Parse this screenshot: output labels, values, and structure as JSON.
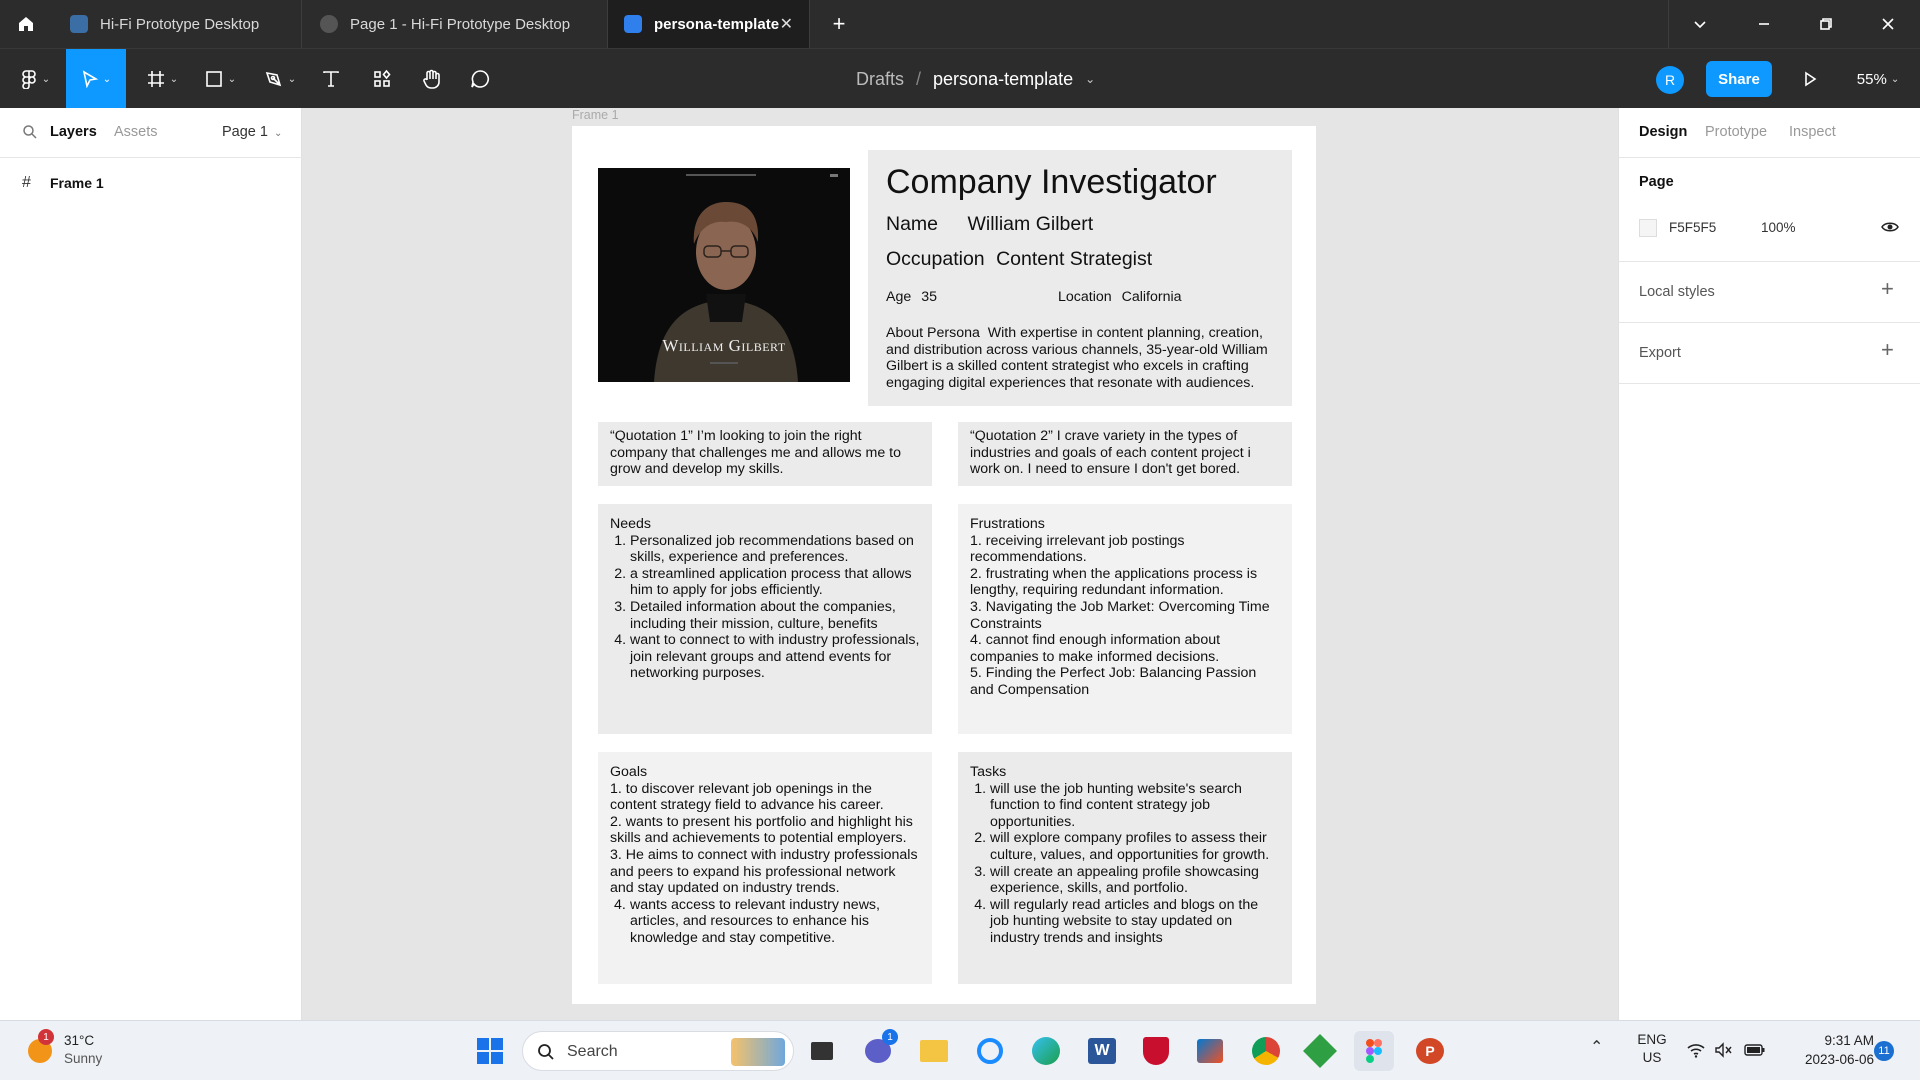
{
  "titlebar": {
    "tabs": [
      {
        "label": "Hi-Fi Prototype Desktop"
      },
      {
        "label": "Page 1 - Hi-Fi Prototype Desktop"
      },
      {
        "label": "persona-template"
      }
    ]
  },
  "toolbar": {
    "breadcrumb_root": "Drafts",
    "breadcrumb_sep": "/",
    "file_name": "persona-template",
    "avatar_initial": "R",
    "share_label": "Share",
    "zoom": "55%"
  },
  "left_panel": {
    "tabs": {
      "layers": "Layers",
      "assets": "Assets"
    },
    "page_selector": "Page 1",
    "layers": [
      {
        "name": "Frame 1"
      }
    ]
  },
  "right_panel": {
    "tabs": {
      "design": "Design",
      "prototype": "Prototype",
      "inspect": "Inspect"
    },
    "page_section_title": "Page",
    "page_color_hex": "F5F5F5",
    "page_color": "#F5F5F5",
    "page_opacity": "100%",
    "local_styles": "Local styles",
    "export": "Export"
  },
  "canvas": {
    "frame_label": "Frame 1",
    "persona": {
      "photo_caption": "William Gilbert",
      "title": "Company Investigator",
      "name_label": "Name",
      "name_value": "William Gilbert",
      "occupation_label": "Occupation",
      "occupation_value": "Content Strategist",
      "age_label": "Age",
      "age_value": "35",
      "location_label": "Location",
      "location_value": "California",
      "about_label": "About Persona",
      "about_text": "With expertise in content planning, creation, and distribution across various channels, 35-year-old William Gilbert is a skilled content strategist who excels in crafting engaging digital experiences that resonate with audiences.",
      "quote1": "“Quotation 1”  I’m looking to join the right company that challenges me and allows me to grow and develop my skills.",
      "quote2": "“Quotation 2” I crave variety in the types of industries and goals of each content project i work on. I need to ensure I don't get bored.",
      "needs_title": "Needs",
      "needs": [
        "Personalized job recommendations based on skills, experience and preferences.",
        "a streamlined application process that allows him to apply for jobs efficiently.",
        "Detailed information about the companies, including their mission, culture, benefits",
        "want to connect to with industry professionals, join relevant groups and attend events for networking purposes."
      ],
      "frustrations_title": "Frustrations",
      "frustrations": [
        " 1. receiving irrelevant job postings recommendations.",
        " 2. frustrating when the applications process is lengthy, requiring redundant information.",
        " 3. Navigating the Job Market: Overcoming Time Constraints",
        " 4. cannot find enough information about companies to make informed decisions.",
        " 5. Finding the Perfect Job: Balancing Passion and Compensation"
      ],
      "goals_title": "Goals",
      "goals": [
        " 1. to discover relevant job openings in the content strategy field to advance his career.",
        " 2. wants to present his portfolio and highlight his skills and achievements to potential employers.",
        " 3. He aims to connect with industry professionals and peers to expand his professional network and stay updated on industry trends."
      ],
      "goals_item4": "wants access to relevant industry news, articles, and resources to enhance his knowledge and stay competitive.",
      "tasks_title": "Tasks",
      "tasks": [
        " will use the job hunting website's search function to find content strategy job opportunities.",
        "will explore company profiles to assess their culture, values, and opportunities for growth.",
        " will create an appealing profile showcasing experience, skills, and portfolio.",
        "will regularly read articles and blogs on the job hunting website to stay updated on industry trends and insights"
      ]
    },
    "help_button": "?"
  },
  "taskbar": {
    "weather_temp": "31°C",
    "weather_desc": "Sunny",
    "weather_badge": "1",
    "search_label": "Search",
    "chat_badge": "1",
    "lang": "ENG",
    "region": "US",
    "time": "9:31 AM",
    "date": "2023-06-06",
    "notif_count": "11"
  }
}
